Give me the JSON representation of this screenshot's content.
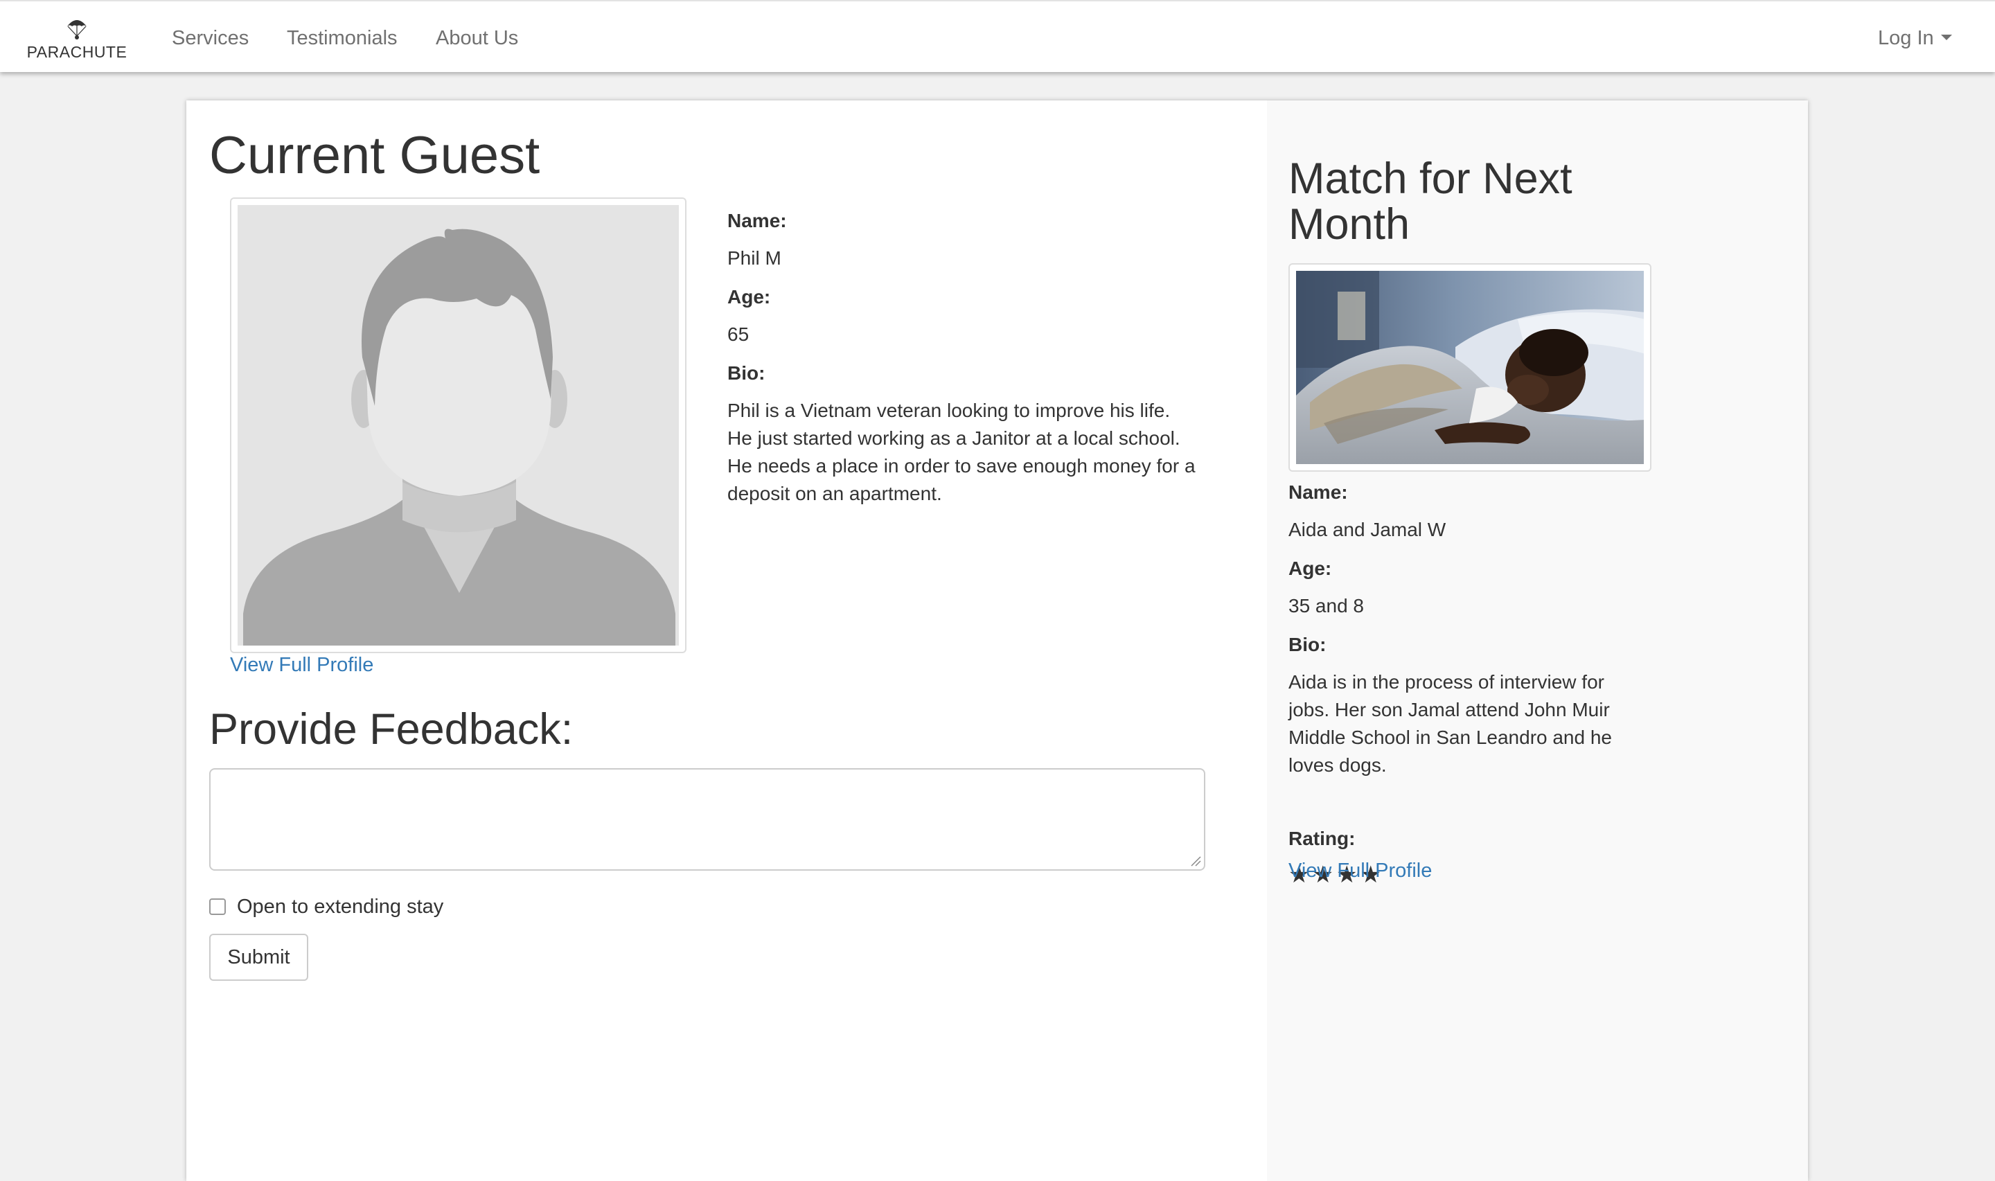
{
  "navbar": {
    "brand": "PARACHUTE",
    "links": [
      "Services",
      "Testimonials",
      "About Us"
    ],
    "login_label": "Log In"
  },
  "current_guest": {
    "title": "Current Guest",
    "name_label": "Name:",
    "name": "Phil M",
    "age_label": "Age:",
    "age": "65",
    "bio_label": "Bio:",
    "bio": "Phil is a Vietnam veteran looking to improve his life. He just started working as a Janitor at a local school. He needs a place in order to save enough money for a deposit on an apartment.",
    "profile_link": "View Full Profile"
  },
  "feedback": {
    "title": "Provide Feedback:",
    "textarea_value": "",
    "checkbox_label": "Open to extending stay",
    "checkbox_checked": false,
    "submit_label": "Submit"
  },
  "next_match": {
    "title": "Match for Next Month",
    "name_label": "Name:",
    "name": "Aida and Jamal W",
    "age_label": "Age:",
    "age": "35 and 8",
    "bio_label": "Bio:",
    "bio": "Aida is in the process of interview for jobs. Her son Jamal attend John Muir Middle School in San Leandro and he loves dogs.",
    "rating_label": "Rating:",
    "rating": 4,
    "rating_stars": "★★★★",
    "profile_link": "View Full Profile"
  },
  "colors": {
    "link": "#337ab7",
    "nav_text": "#707070",
    "text": "#333333",
    "page_bg": "#f1f1f1"
  }
}
